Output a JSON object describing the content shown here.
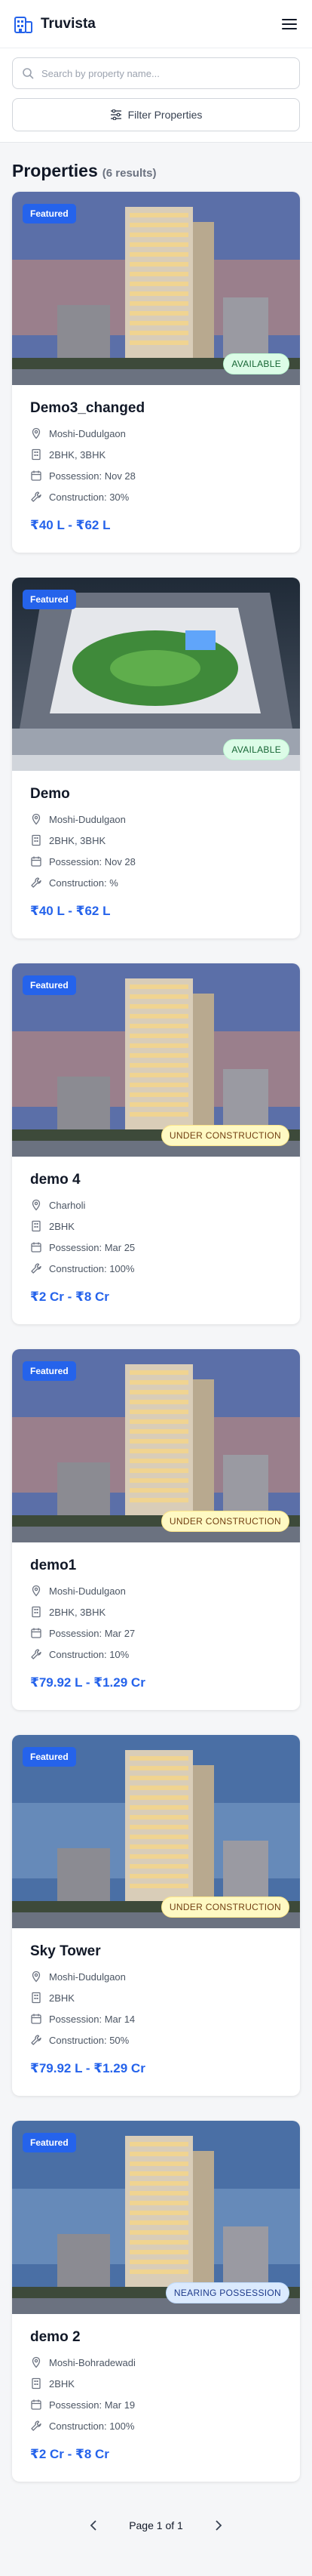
{
  "app": {
    "name": "Truvista"
  },
  "search": {
    "placeholder": "Search by property name..."
  },
  "filter": {
    "label": "Filter Properties"
  },
  "listing": {
    "title": "Properties",
    "count_label": "(6 results)"
  },
  "properties": [
    {
      "badge": "Featured",
      "status": "AVAILABLE",
      "status_kind": "available",
      "name": "Demo3_changed",
      "location": "Moshi-Dudulgaon",
      "config": "2BHK, 3BHK",
      "possession": "Possession: Nov 28",
      "construction": "Construction: 30%",
      "price": "₹40 L - ₹62 L"
    },
    {
      "badge": "Featured",
      "status": "AVAILABLE",
      "status_kind": "available",
      "name": "Demo",
      "location": "Moshi-Dudulgaon",
      "config": "2BHK, 3BHK",
      "possession": "Possession: Nov 28",
      "construction": "Construction: %",
      "price": "₹40 L - ₹62 L"
    },
    {
      "badge": "Featured",
      "status": "UNDER CONSTRUCTION",
      "status_kind": "construction",
      "name": "demo 4",
      "location": "Charholi",
      "config": "2BHK",
      "possession": "Possession: Mar 25",
      "construction": "Construction: 100%",
      "price": "₹2 Cr - ₹8 Cr"
    },
    {
      "badge": "Featured",
      "status": "UNDER CONSTRUCTION",
      "status_kind": "construction",
      "name": "demo1",
      "location": "Moshi-Dudulgaon",
      "config": "2BHK, 3BHK",
      "possession": "Possession: Mar 27",
      "construction": "Construction: 10%",
      "price": "₹79.92 L - ₹1.29 Cr"
    },
    {
      "badge": "Featured",
      "status": "UNDER CONSTRUCTION",
      "status_kind": "construction",
      "name": "Sky Tower",
      "location": "Moshi-Dudulgaon",
      "config": "2BHK",
      "possession": "Possession: Mar 14",
      "construction": "Construction: 50%",
      "price": "₹79.92 L - ₹1.29 Cr"
    },
    {
      "badge": "Featured",
      "status": "NEARING POSSESSION",
      "status_kind": "nearing",
      "name": "demo 2",
      "location": "Moshi-Bohradewadi",
      "config": "2BHK",
      "possession": "Possession: Mar 19",
      "construction": "Construction: 100%",
      "price": "₹2 Cr - ₹8 Cr"
    }
  ],
  "pagination": {
    "label": "Page 1 of 1"
  },
  "colors": {
    "accent": "#2563eb",
    "available": "#166534",
    "construction": "#713f12",
    "nearing": "#1e3a8a"
  }
}
